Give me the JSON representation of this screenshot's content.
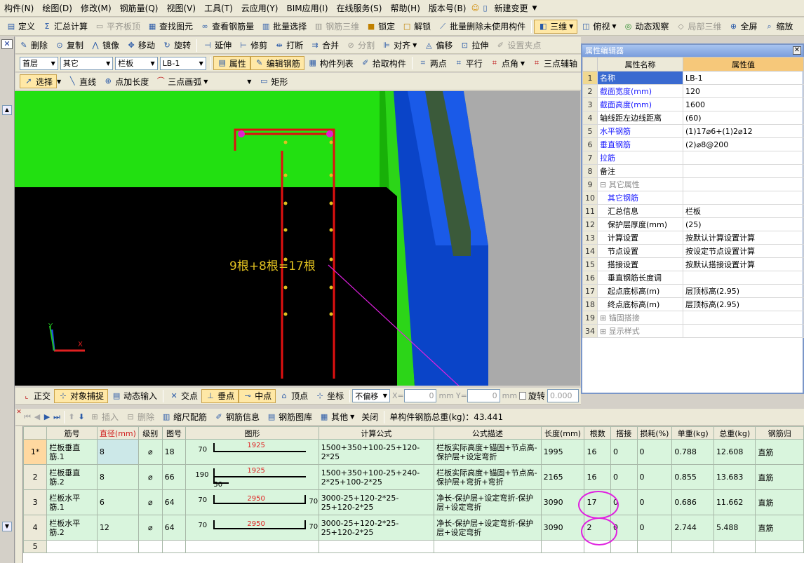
{
  "menu": [
    "构件(N)",
    "绘图(D)",
    "修改(M)",
    "钢筋量(Q)",
    "视图(V)",
    "工具(T)",
    "云应用(Y)",
    "BIM应用(I)",
    "在线服务(S)",
    "帮助(H)",
    "版本号(B)",
    "新建变更"
  ],
  "toolbar1": [
    "定义",
    "汇总计算",
    "平齐板顶",
    "查找图元",
    "查看钢筋量",
    "批量选择",
    "钢筋三维",
    "锁定",
    "解锁",
    "批量删除未使用构件",
    "三维",
    "俯视",
    "动态观察",
    "局部三维",
    "全屏",
    "缩放"
  ],
  "toolbar2": [
    "删除",
    "复制",
    "镜像",
    "移动",
    "旋转",
    "延伸",
    "修剪",
    "打断",
    "合并",
    "分割",
    "对齐",
    "偏移",
    "拉伸",
    "设置夹点"
  ],
  "toolbar3": {
    "floor": "首层",
    "type": "其它",
    "component": "栏板",
    "name": "LB-1",
    "buttons": [
      "属性",
      "编辑钢筋",
      "构件列表",
      "拾取构件",
      "两点",
      "平行",
      "点角",
      "三点辅轴"
    ]
  },
  "toolbar4": [
    "选择",
    "直线",
    "点加长度",
    "三点画弧",
    "矩形"
  ],
  "viewport": {
    "annotation": "9根+8根=17根",
    "axis_x": "X",
    "axis_y": "Y"
  },
  "snapbar": {
    "items": [
      "正交",
      "对象捕捉",
      "动态输入",
      "交点",
      "垂点",
      "中点",
      "顶点",
      "坐标"
    ],
    "move_mode": "不偏移",
    "x_label": "X=",
    "x_val": "0",
    "y_label": "Y=",
    "y_val": "0",
    "unit": "mm",
    "rotate": "旋转",
    "rotate_val": "0.000"
  },
  "gridbar": {
    "items": [
      "插入",
      "删除",
      "缩尺配筋",
      "钢筋信息",
      "钢筋图库",
      "其他",
      "关闭"
    ],
    "total": "单构件钢筋总重(kg)：43.441"
  },
  "props": {
    "title": "属性编辑器",
    "header": [
      "属性名称",
      "属性值"
    ],
    "rows": [
      {
        "n": "1",
        "k": "名称",
        "v": "LB-1",
        "c": "blue"
      },
      {
        "n": "2",
        "k": "截面宽度(mm)",
        "v": "120",
        "c": "blue"
      },
      {
        "n": "3",
        "k": "截面高度(mm)",
        "v": "1600",
        "c": "blue"
      },
      {
        "n": "4",
        "k": "轴线距左边线距离",
        "v": "(60)",
        "c": ""
      },
      {
        "n": "5",
        "k": "水平钢筋",
        "v": "(1)17⌀6+(1)2⌀12",
        "c": "blue"
      },
      {
        "n": "6",
        "k": "垂直钢筋",
        "v": "(2)⌀8@200",
        "c": "blue"
      },
      {
        "n": "7",
        "k": "拉筋",
        "v": "",
        "c": "blue"
      },
      {
        "n": "8",
        "k": "备注",
        "v": "",
        "c": ""
      },
      {
        "n": "9",
        "k": "⊟ 其它属性",
        "v": "",
        "c": "gray"
      },
      {
        "n": "10",
        "k": "其它钢筋",
        "v": "",
        "c": "blue"
      },
      {
        "n": "11",
        "k": "汇总信息",
        "v": "栏板",
        "c": ""
      },
      {
        "n": "12",
        "k": "保护层厚度(mm)",
        "v": "(25)",
        "c": ""
      },
      {
        "n": "13",
        "k": "计算设置",
        "v": "按默认计算设置计算",
        "c": ""
      },
      {
        "n": "14",
        "k": "节点设置",
        "v": "按设定节点设置计算",
        "c": ""
      },
      {
        "n": "15",
        "k": "搭接设置",
        "v": "按默认搭接设置计算",
        "c": ""
      },
      {
        "n": "16",
        "k": "垂直钢筋长度调",
        "v": "",
        "c": ""
      },
      {
        "n": "17",
        "k": "起点底标高(m)",
        "v": "层顶标高(2.95)",
        "c": ""
      },
      {
        "n": "18",
        "k": "终点底标高(m)",
        "v": "层顶标高(2.95)",
        "c": ""
      },
      {
        "n": "19",
        "k": "⊞ 锚固搭接",
        "v": "",
        "c": "gray"
      },
      {
        "n": "34",
        "k": "⊞ 显示样式",
        "v": "",
        "c": "gray"
      }
    ]
  },
  "grid": {
    "headers": [
      "",
      "筋号",
      "直径(mm)",
      "级别",
      "图号",
      "图形",
      "计算公式",
      "公式描述",
      "长度(mm)",
      "根数",
      "搭接",
      "损耗(%)",
      "单重(kg)",
      "总重(kg)",
      "钢筋归"
    ],
    "rows": [
      {
        "rn": "1*",
        "name": "栏板垂直筋.1",
        "d": "8",
        "grade": "⌀",
        "fig": "18",
        "s_left": "70",
        "s_mid": "1925",
        "s_right": "",
        "formula": "1500+350+100-25+120-2*25",
        "desc": "栏板实际高度+锚固+节点高-保护层+设定弯折",
        "len": "1995",
        "count": "16",
        "lap": "0",
        "loss": "0",
        "unit": "0.788",
        "total": "12.608",
        "type": "直筋"
      },
      {
        "rn": "2",
        "name": "栏板垂直筋.2",
        "d": "8",
        "grade": "⌀",
        "fig": "66",
        "s_left": "190",
        "s_mid": "1925",
        "s_right": "50",
        "formula": "1500+350+100-25+240-2*25+100-2*25",
        "desc": "栏板实际高度+锚固+节点高-保护层+弯折+弯折",
        "len": "2165",
        "count": "16",
        "lap": "0",
        "loss": "0",
        "unit": "0.855",
        "total": "13.683",
        "type": "直筋"
      },
      {
        "rn": "3",
        "name": "栏板水平筋.1",
        "d": "6",
        "grade": "⌀",
        "fig": "64",
        "s_left": "70",
        "s_mid": "2950",
        "s_right": "70",
        "formula": "3000-25+120-2*25-25+120-2*25",
        "desc": "净长-保护层+设定弯折-保护层+设定弯折",
        "len": "3090",
        "count": "17",
        "lap": "0",
        "loss": "0",
        "unit": "0.686",
        "total": "11.662",
        "type": "直筋"
      },
      {
        "rn": "4",
        "name": "栏板水平筋.2",
        "d": "12",
        "grade": "⌀",
        "fig": "64",
        "s_left": "70",
        "s_mid": "2950",
        "s_right": "70",
        "formula": "3000-25+120-2*25-25+120-2*25",
        "desc": "净长-保护层+设定弯折-保护层+设定弯折",
        "len": "3090",
        "count": "2",
        "lap": "0",
        "loss": "0",
        "unit": "2.744",
        "total": "5.488",
        "type": "直筋"
      },
      {
        "rn": "5",
        "name": "",
        "d": "",
        "grade": "",
        "fig": "",
        "s_left": "",
        "s_mid": "",
        "s_right": "",
        "formula": "",
        "desc": "",
        "len": "",
        "count": "",
        "lap": "",
        "loss": "",
        "unit": "",
        "total": "",
        "type": ""
      }
    ]
  }
}
